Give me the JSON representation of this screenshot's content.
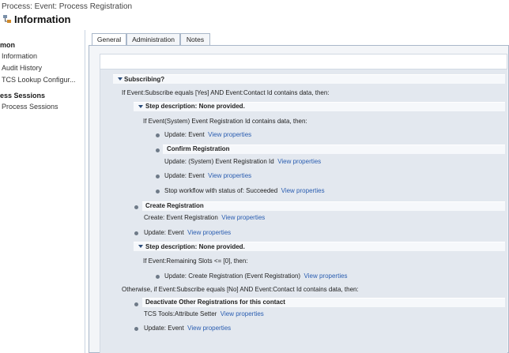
{
  "header": {
    "breadcrumb": "Process: Event: Process Registration",
    "title": "Information"
  },
  "sidebar": {
    "common_head": "mon",
    "items": [
      "Information",
      "Audit History",
      "TCS Lookup Configur..."
    ],
    "sessions_head": "ess Sessions",
    "session_items": [
      "Process Sessions"
    ]
  },
  "tabs": [
    "General",
    "Administration",
    "Notes"
  ],
  "workflow": {
    "subscribing_label": "Subscribing?",
    "cond1": "If Event:Subscribe equals [Yes] AND Event:Contact Id contains data, then:",
    "step1_label": "Step description: None provided.",
    "cond2": "If Event(System) Event Registration Id contains data, then:",
    "update_event_1": "Update:  Event",
    "confirm_reg_label": "Confirm Registration",
    "update_sys_reg": "Update:  (System) Event Registration Id",
    "update_event_2": "Update:  Event",
    "stop_wf": "Stop workflow with status of:  Succeeded",
    "create_reg_label": "Create Registration",
    "create_event_reg": "Create:  Event Registration",
    "update_event_3": "Update:  Event",
    "step2_label": "Step description: None provided.",
    "cond3": "If Event:Remaining Slots <= [0], then:",
    "update_create_reg": "Update:  Create Registration (Event Registration)",
    "otherwise": "Otherwise, if Event:Subscribe equals [No] AND Event:Contact Id contains data, then:",
    "deactivate_label": "Deactivate Other Registrations for this contact",
    "tcs_tools": "TCS Tools:Attribute Setter",
    "update_event_4": "Update:  Event",
    "view_properties": "View properties"
  },
  "colors": {
    "accent": "#2a5db0",
    "workflow_bg": "#e3e8ef",
    "border": "#a9b7c9"
  }
}
